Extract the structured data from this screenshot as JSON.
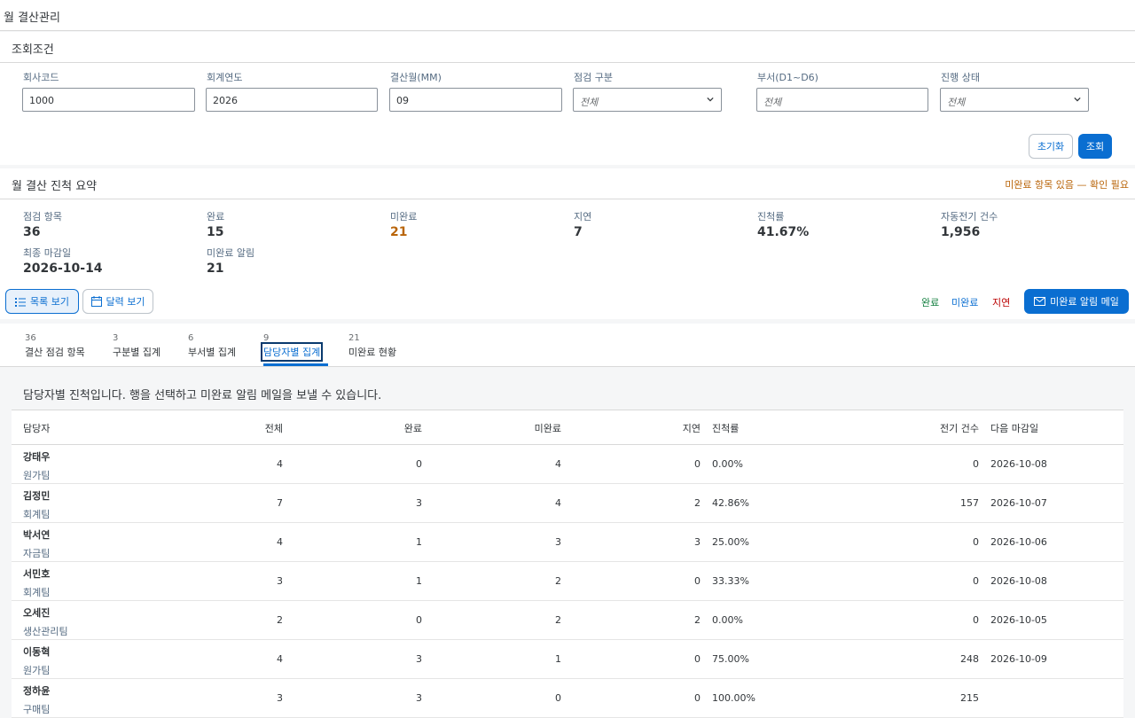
{
  "page_title": "월 결산관리",
  "search": {
    "header": "조회조건",
    "fields": [
      {
        "label": "회사코드",
        "value": "1000",
        "placeholder": ""
      },
      {
        "label": "회계연도",
        "value": "2026",
        "placeholder": ""
      },
      {
        "label": "결산월(MM)",
        "value": "09",
        "placeholder": ""
      },
      {
        "label": "점검 구분",
        "value": "",
        "placeholder": "전체"
      },
      {
        "label": "부서(D1~D6)",
        "value": "",
        "placeholder": "전체"
      },
      {
        "label": "진행 상태",
        "value": "",
        "placeholder": "전체"
      }
    ],
    "reset_label": "초기화",
    "search_label": "조회"
  },
  "summary": {
    "header": "월 결산 진척 요약",
    "warning": "미완료 항목 있음 — 확인 필요",
    "warning_color": "#b9650a",
    "kpis": [
      {
        "label": "점검 항목",
        "value": "36"
      },
      {
        "label": "완료",
        "value": "15"
      },
      {
        "label": "미완료",
        "value": "21"
      },
      {
        "label": "지연",
        "value": "7"
      },
      {
        "label": "진척률",
        "value": "41.67%"
      },
      {
        "label": "자동전기 건수",
        "value": "1,956"
      },
      {
        "label": "최종 마감일",
        "value": "2026-10-14"
      },
      {
        "label": "미완료 알림",
        "value": "21"
      }
    ]
  },
  "toolbar": {
    "list_view": "목록 보기",
    "calendar_view": "달력 보기",
    "legend_done": "완료",
    "legend_incomplete": "미완료",
    "legend_delayed": "지연",
    "mail_button": "미완료 알림 메일",
    "colors": {
      "done": "#107e3e",
      "incomplete": "#0a6ed1",
      "delayed": "#bb0000"
    }
  },
  "tabs": [
    {
      "count": "36",
      "label": "결산 점검 항목"
    },
    {
      "count": "3",
      "label": "구분별 집계"
    },
    {
      "count": "6",
      "label": "부서별 집계"
    },
    {
      "count": "9",
      "label": "담당자별 집계"
    },
    {
      "count": "21",
      "label": "미완료 현황"
    }
  ],
  "table": {
    "description": "담당자별 진척입니다. 행을 선택하고 미완료 알림 메일을 보낼 수 있습니다.",
    "columns": [
      "담당자",
      "전체",
      "완료",
      "미완료",
      "지연",
      "진척률",
      "전기 건수",
      "다음 마감일"
    ],
    "rows": [
      {
        "name": "강태우",
        "team": "원가팀",
        "total": "4",
        "done": "0",
        "incomplete": "4",
        "delayed": "0",
        "progress": "0.00%",
        "postings": "0",
        "next_due": "2026-10-08"
      },
      {
        "name": "김정민",
        "team": "회계팀",
        "total": "7",
        "done": "3",
        "incomplete": "4",
        "delayed": "2",
        "progress": "42.86%",
        "postings": "157",
        "next_due": "2026-10-07"
      },
      {
        "name": "박서연",
        "team": "자금팀",
        "total": "4",
        "done": "1",
        "incomplete": "3",
        "delayed": "3",
        "progress": "25.00%",
        "postings": "0",
        "next_due": "2026-10-06"
      },
      {
        "name": "서민호",
        "team": "회계팀",
        "total": "3",
        "done": "1",
        "incomplete": "2",
        "delayed": "0",
        "progress": "33.33%",
        "postings": "0",
        "next_due": "2026-10-08"
      },
      {
        "name": "오세진",
        "team": "생산관리팀",
        "total": "2",
        "done": "0",
        "incomplete": "2",
        "delayed": "2",
        "progress": "0.00%",
        "postings": "0",
        "next_due": "2026-10-05"
      },
      {
        "name": "이동혁",
        "team": "원가팀",
        "total": "4",
        "done": "3",
        "incomplete": "1",
        "delayed": "0",
        "progress": "75.00%",
        "postings": "248",
        "next_due": "2026-10-09"
      },
      {
        "name": "정하윤",
        "team": "구매팀",
        "total": "3",
        "done": "3",
        "incomplete": "0",
        "delayed": "0",
        "progress": "100.00%",
        "postings": "215",
        "next_due": ""
      }
    ]
  }
}
